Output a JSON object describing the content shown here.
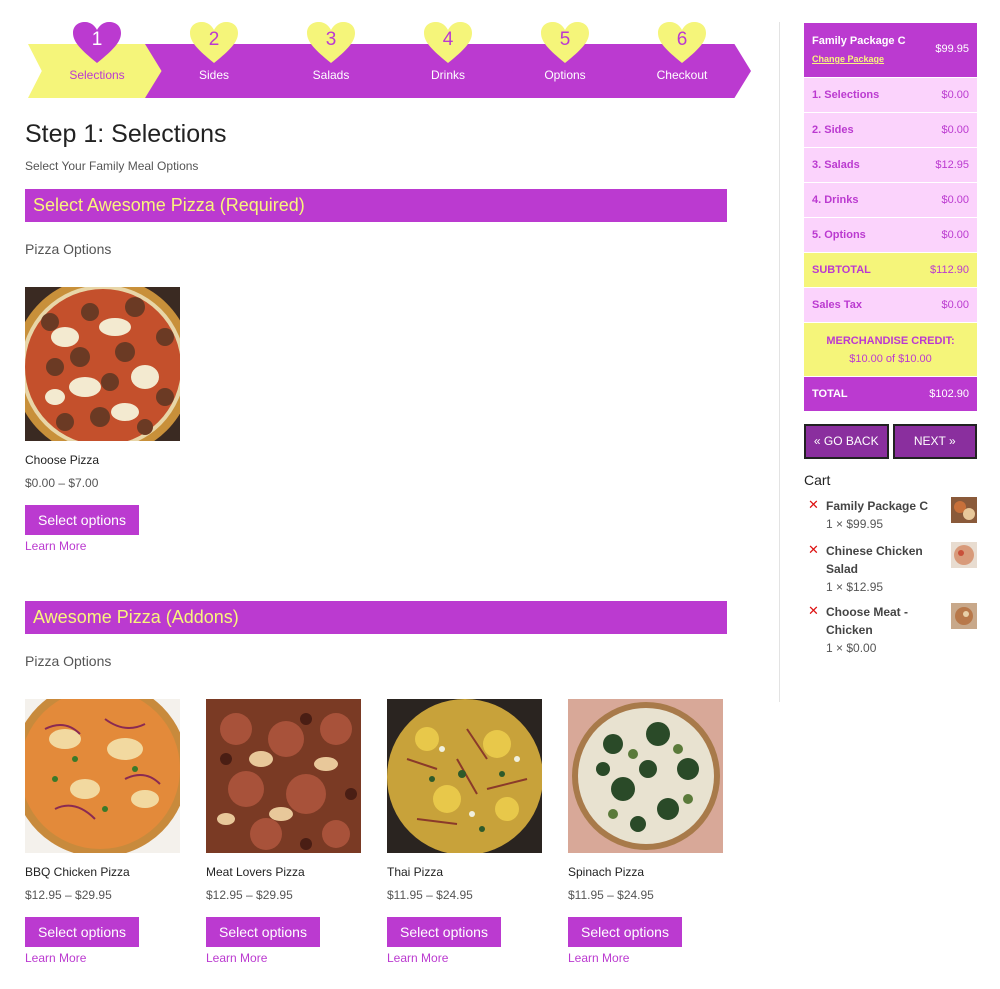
{
  "colors": {
    "accent": "#bb3ad0",
    "yellow": "#f5f57a",
    "pink": "#fbd3fc",
    "dark_purple": "#8a2f9e"
  },
  "steps": [
    {
      "num": "1",
      "label": "Selections"
    },
    {
      "num": "2",
      "label": "Sides"
    },
    {
      "num": "3",
      "label": "Salads"
    },
    {
      "num": "4",
      "label": "Drinks"
    },
    {
      "num": "5",
      "label": "Options"
    },
    {
      "num": "6",
      "label": "Checkout"
    }
  ],
  "page": {
    "title": "Step 1: Selections",
    "subtitle": "Select Your Family Meal Options"
  },
  "sections": [
    {
      "header": "Select Awesome Pizza (Required)",
      "subtitle": "Pizza Options",
      "products": [
        {
          "name": "Choose Pizza",
          "price": "$0.00 – $7.00",
          "button": "Select options",
          "link": "Learn More"
        }
      ]
    },
    {
      "header": "Awesome Pizza (Addons)",
      "subtitle": "Pizza Options",
      "products": [
        {
          "name": "BBQ Chicken Pizza",
          "price": "$12.95 – $29.95",
          "button": "Select options",
          "link": "Learn More"
        },
        {
          "name": "Meat Lovers Pizza",
          "price": "$12.95 – $29.95",
          "button": "Select options",
          "link": "Learn More"
        },
        {
          "name": "Thai Pizza",
          "price": "$11.95 – $24.95",
          "button": "Select options",
          "link": "Learn More"
        },
        {
          "name": "Spinach Pizza",
          "price": "$11.95 – $24.95",
          "button": "Select options",
          "link": "Learn More"
        }
      ]
    }
  ],
  "sidebar": {
    "package": {
      "name": "Family Package C",
      "change": "Change Package",
      "price": "$99.95"
    },
    "lines": [
      {
        "label": "1. Selections",
        "value": "$0.00"
      },
      {
        "label": "2. Sides",
        "value": "$0.00"
      },
      {
        "label": "3. Salads",
        "value": "$12.95"
      },
      {
        "label": "4. Drinks",
        "value": "$0.00"
      },
      {
        "label": "5. Options",
        "value": "$0.00"
      }
    ],
    "subtotal": {
      "label": "SUBTOTAL",
      "value": "$112.90"
    },
    "tax": {
      "label": "Sales Tax",
      "value": "$0.00"
    },
    "credit": {
      "label": "MERCHANDISE CREDIT:",
      "value": "$10.00 of $10.00"
    },
    "total": {
      "label": "TOTAL",
      "value": "$102.90"
    },
    "back_label": "« GO BACK",
    "next_label": "NEXT »"
  },
  "cart": {
    "title": "Cart",
    "items": [
      {
        "name": "Family Package C",
        "qty": "1 × $99.95"
      },
      {
        "name": "Chinese Chicken Salad",
        "qty": "1 × $12.95"
      },
      {
        "name": "Choose Meat - Chicken",
        "qty": "1 × $0.00"
      }
    ]
  }
}
